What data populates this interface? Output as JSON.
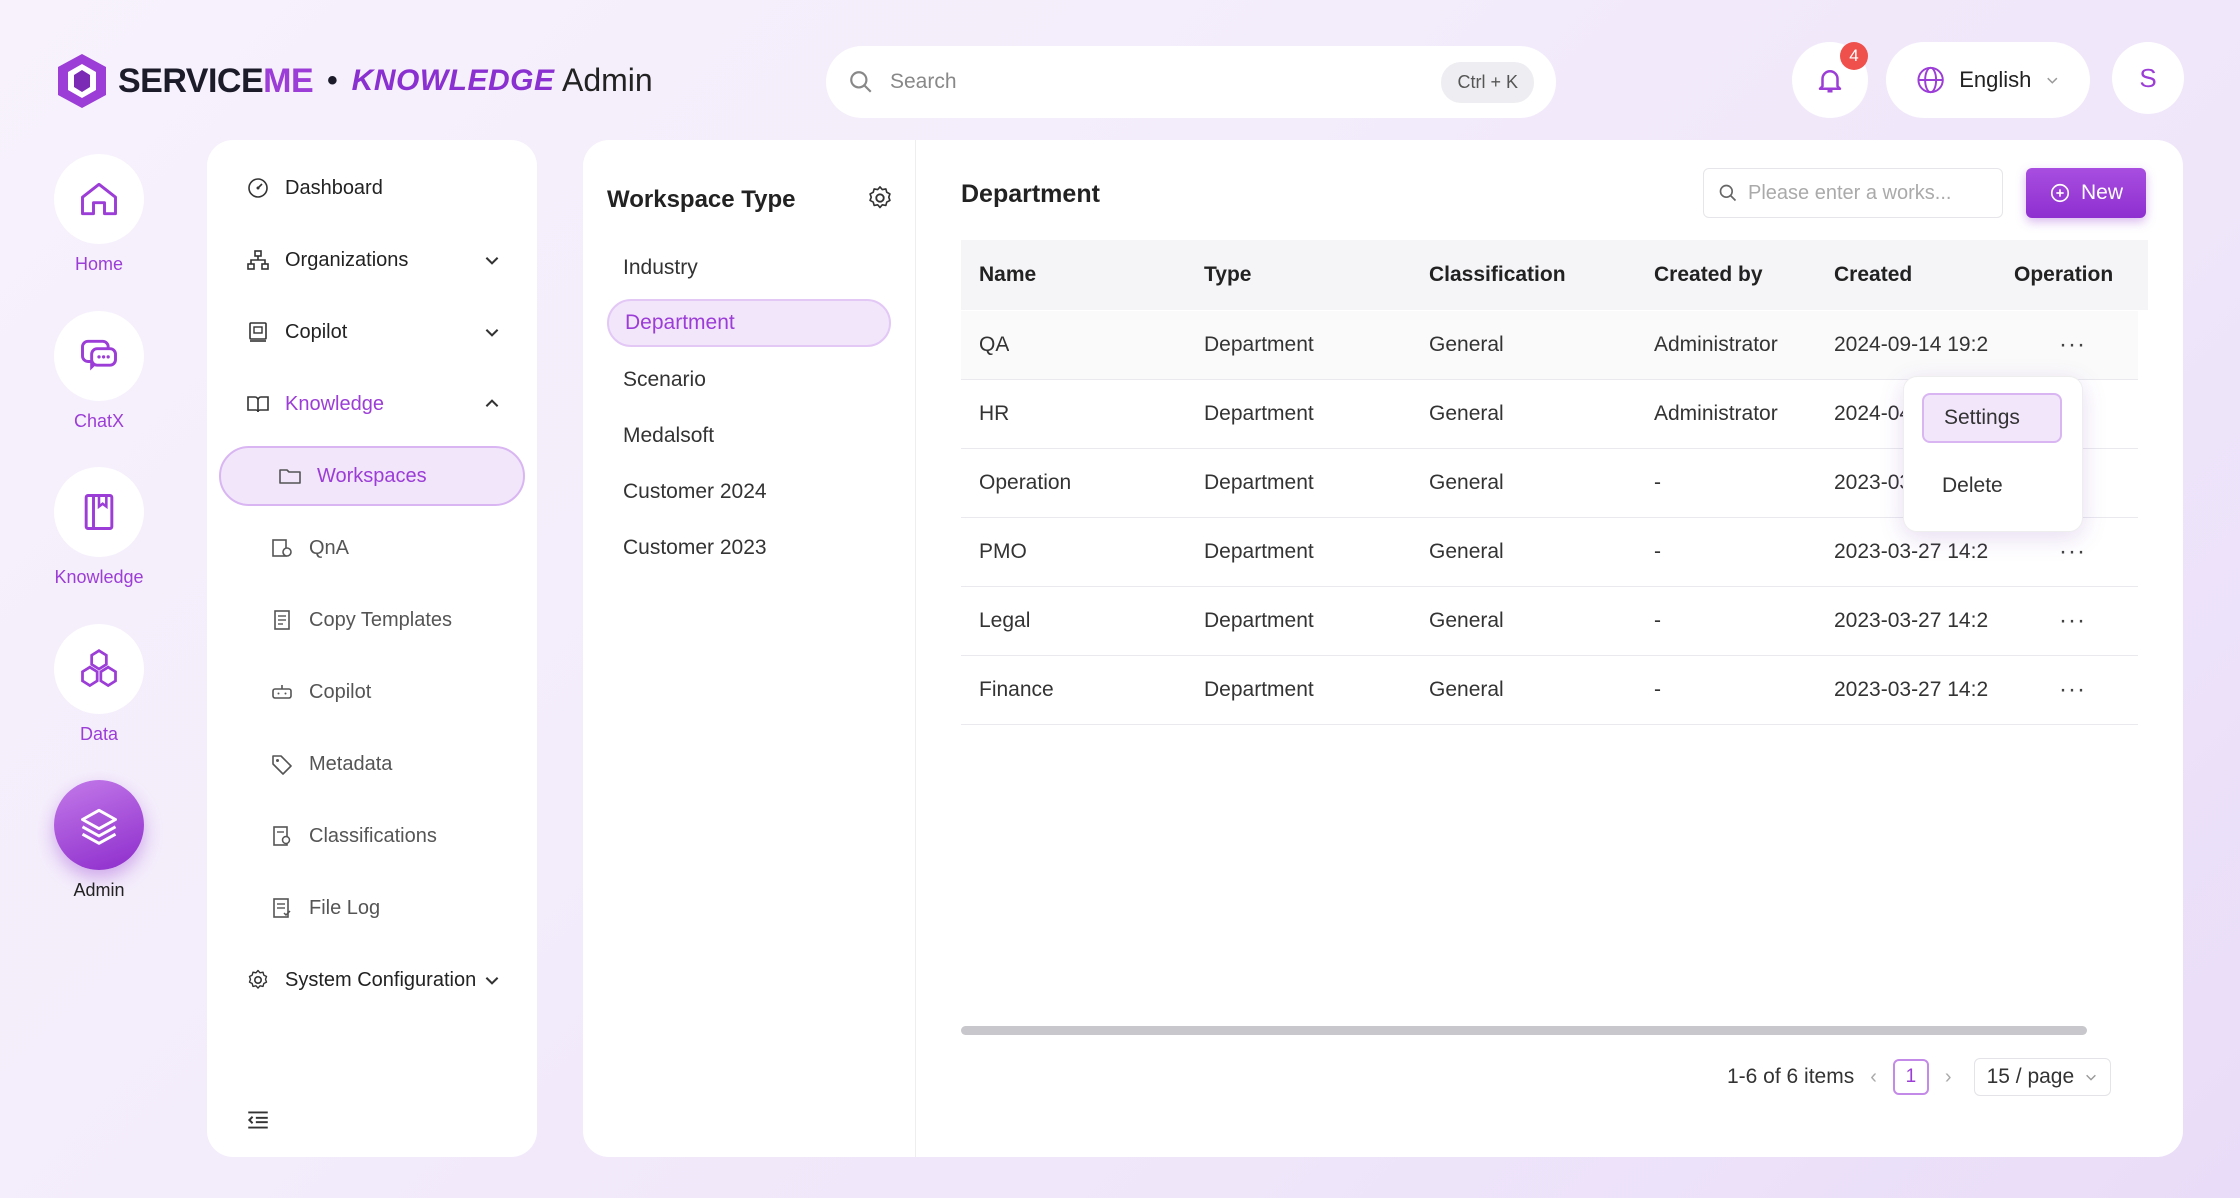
{
  "header": {
    "brand_left": "SERVICE",
    "brand_accent": "ME",
    "brand_sep": "•",
    "brand_product": "KNOWLEDGE",
    "title": "Admin",
    "search_placeholder": "Search",
    "search_shortcut": "Ctrl + K",
    "notification_count": "4",
    "language": "English",
    "avatar_initial": "S"
  },
  "rail": [
    {
      "label": "Home",
      "icon": "home-icon"
    },
    {
      "label": "ChatX",
      "icon": "chat-icon"
    },
    {
      "label": "Knowledge",
      "icon": "book-icon"
    },
    {
      "label": "Data",
      "icon": "hexagons-icon"
    },
    {
      "label": "Admin",
      "icon": "layers-icon"
    }
  ],
  "sidebar": {
    "items": [
      {
        "label": "Dashboard",
        "icon": "dashboard-icon"
      },
      {
        "label": "Organizations",
        "icon": "org-icon"
      },
      {
        "label": "Copilot",
        "icon": "copilot-icon"
      },
      {
        "label": "Knowledge",
        "icon": "book-open-icon"
      },
      {
        "label": "Workspaces",
        "icon": "folder-icon"
      },
      {
        "label": "QnA",
        "icon": "qna-icon"
      },
      {
        "label": "Copy Templates",
        "icon": "template-icon"
      },
      {
        "label": "Copilot",
        "icon": "robot-icon"
      },
      {
        "label": "Metadata",
        "icon": "tag-icon"
      },
      {
        "label": "Classifications",
        "icon": "classification-icon"
      },
      {
        "label": "File Log",
        "icon": "file-log-icon"
      },
      {
        "label": "System Configuration",
        "icon": "gear-icon"
      }
    ]
  },
  "workspace_types": {
    "title": "Workspace Type",
    "items": [
      "Industry",
      "Department",
      "Scenario",
      "Medalsoft",
      "Customer 2024",
      "Customer 2023"
    ],
    "selected": "Department"
  },
  "department": {
    "title": "Department",
    "search_placeholder": "Please enter a works...",
    "new_label": "New",
    "columns": [
      "Name",
      "Type",
      "Classification",
      "Created by",
      "Created",
      "Operation"
    ],
    "rows": [
      {
        "name": "QA",
        "type": "Department",
        "classification": "General",
        "created_by": "Administrator",
        "created": "2024-09-14 19:2",
        "op": "···"
      },
      {
        "name": "HR",
        "type": "Department",
        "classification": "General",
        "created_by": "Administrator",
        "created": "2024-04",
        "op": ""
      },
      {
        "name": "Operation",
        "type": "Department",
        "classification": "General",
        "created_by": "-",
        "created": "2023-03",
        "op": ""
      },
      {
        "name": "PMO",
        "type": "Department",
        "classification": "General",
        "created_by": "-",
        "created": "2023-03-27 14:2",
        "op": "···"
      },
      {
        "name": "Legal",
        "type": "Department",
        "classification": "General",
        "created_by": "-",
        "created": "2023-03-27 14:2",
        "op": "···"
      },
      {
        "name": "Finance",
        "type": "Department",
        "classification": "General",
        "created_by": "-",
        "created": "2023-03-27 14:2",
        "op": "···"
      }
    ],
    "menu": {
      "settings": "Settings",
      "delete": "Delete"
    },
    "pagination": {
      "summary": "1-6 of 6 items",
      "current_page": "1",
      "page_size": "15 / page"
    }
  },
  "colors": {
    "accent": "#9b3dd6",
    "badge": "#f0504c"
  }
}
